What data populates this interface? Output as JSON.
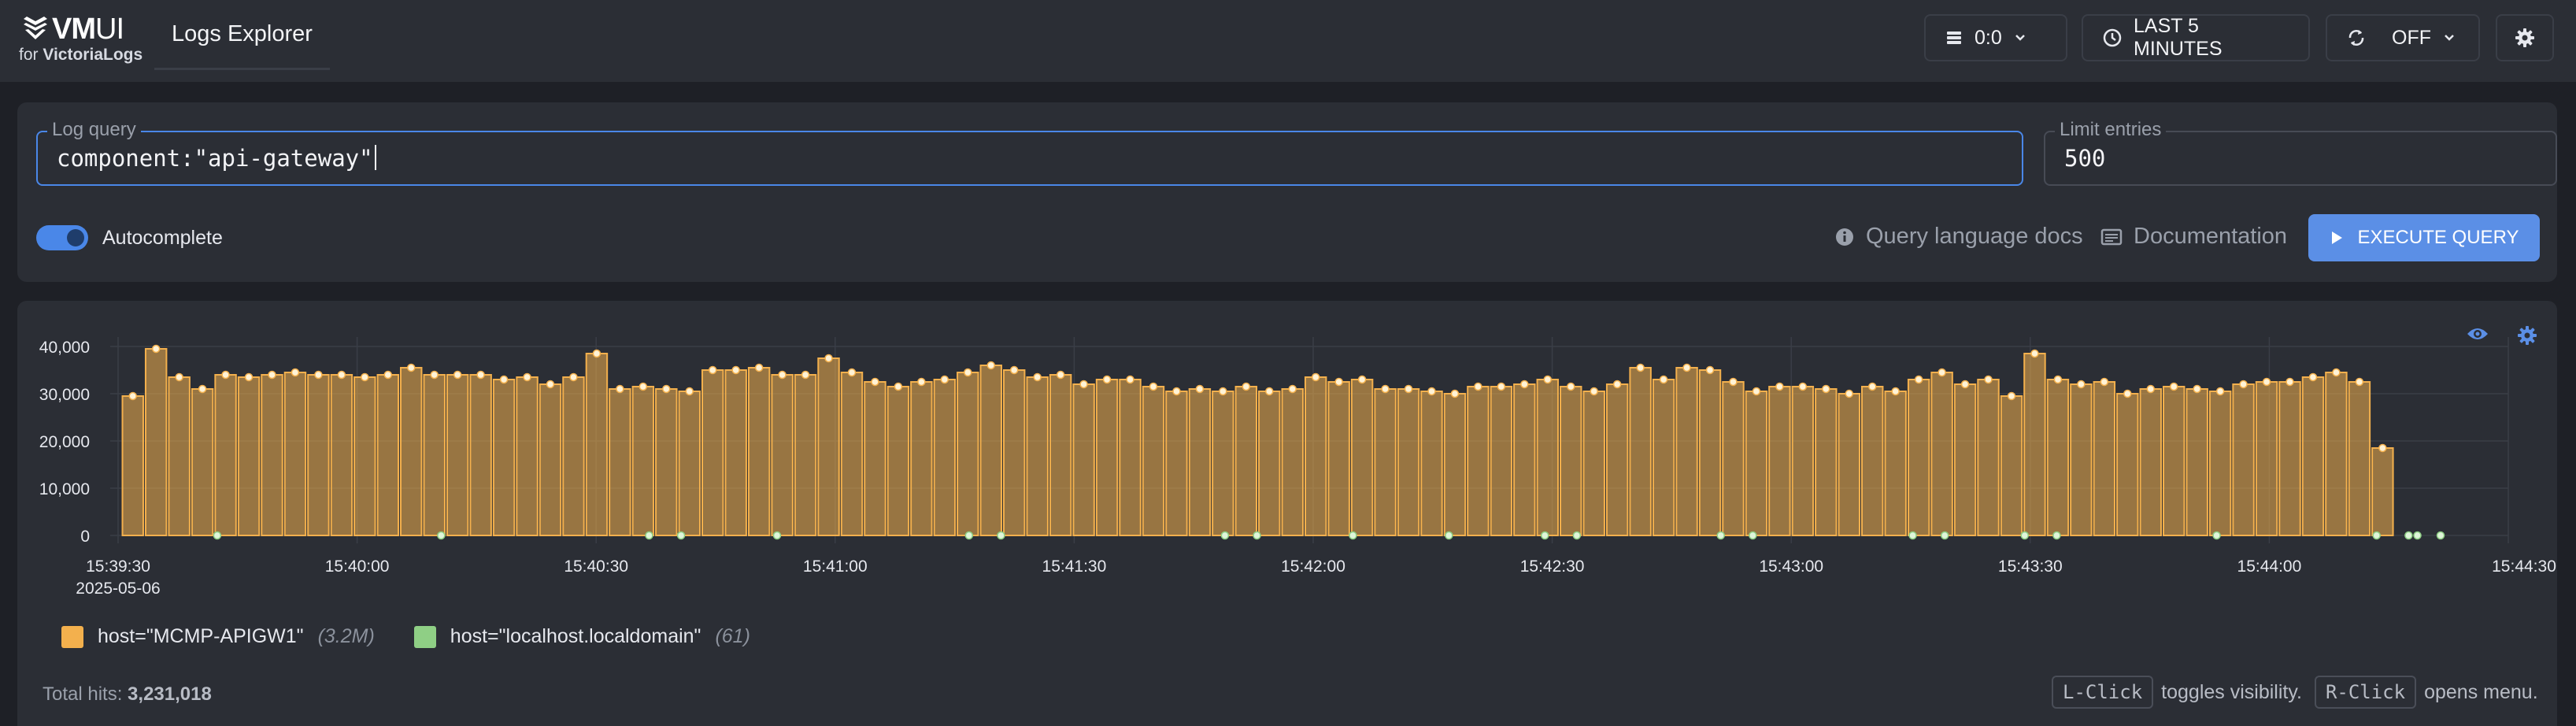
{
  "header": {
    "logo_title": "VM",
    "logo_title_suffix": "UI",
    "logo_sub_prefix": "for ",
    "logo_sub_brand": "VictoriaLogs",
    "nav_tab": "Logs Explorer",
    "tenant": "0:0",
    "time_range": "LAST 5 MINUTES",
    "refresh": "OFF"
  },
  "query": {
    "query_legend": "Log query",
    "query_value": "component:\"api-gateway\"",
    "limit_legend": "Limit entries",
    "limit_value": "500",
    "autocomplete_label": "Autocomplete",
    "autocomplete_on": true,
    "docs_query_label": "Query language docs",
    "docs_label": "Documentation",
    "execute_label": "EXECUTE QUERY"
  },
  "colors": {
    "accent": "#5b8fe6",
    "series1": "#f3b04d",
    "series2": "#8fcf85"
  },
  "chart_data": {
    "type": "bar",
    "x_ticks": [
      "15:39:30",
      "15:40:00",
      "15:40:30",
      "15:41:00",
      "15:41:30",
      "15:42:00",
      "15:42:30",
      "15:43:00",
      "15:43:30",
      "15:44:00",
      "15:44:30"
    ],
    "x_date": "2025-05-06",
    "y_ticks": [
      "40,000",
      "30,000",
      "20,000",
      "10,000",
      "0"
    ],
    "ylim": [
      0,
      40000
    ],
    "grid": true,
    "series": [
      {
        "name": "host=\"MCMP-APIGW1\"",
        "count": "(3.2M)",
        "values": [
          29500,
          39500,
          33500,
          31000,
          34000,
          33500,
          34000,
          34500,
          34000,
          34000,
          33500,
          34000,
          35500,
          34000,
          34000,
          34000,
          33000,
          33500,
          32000,
          33500,
          38500,
          31000,
          31500,
          31000,
          30500,
          35000,
          35000,
          35500,
          34000,
          34000,
          37500,
          34500,
          32500,
          31500,
          32500,
          33000,
          34500,
          36000,
          35000,
          33500,
          34000,
          32000,
          33000,
          33000,
          31500,
          30500,
          31000,
          30500,
          31500,
          30500,
          31000,
          33500,
          32500,
          33000,
          31000,
          31000,
          30500,
          30000,
          31500,
          31500,
          32000,
          33000,
          31500,
          30500,
          32000,
          35500,
          33000,
          35500,
          35000,
          32500,
          30500,
          31500,
          31500,
          31000,
          30000,
          31500,
          30500,
          33000,
          34500,
          32000,
          33000,
          29500,
          38500,
          33000,
          32000,
          32500,
          30000,
          31000,
          31500,
          31000,
          30500,
          32000,
          32500,
          32500,
          33500,
          34500,
          32500,
          18500
        ]
      },
      {
        "name": "host=\"localhost.localdomain\"",
        "count": "(61)"
      }
    ]
  },
  "footer": {
    "total_label": "Total hits: ",
    "total_value": "3,231,018",
    "lclick_key": "L-Click",
    "lclick_text": "toggles visibility.",
    "rclick_key": "R-Click",
    "rclick_text": "opens menu."
  }
}
